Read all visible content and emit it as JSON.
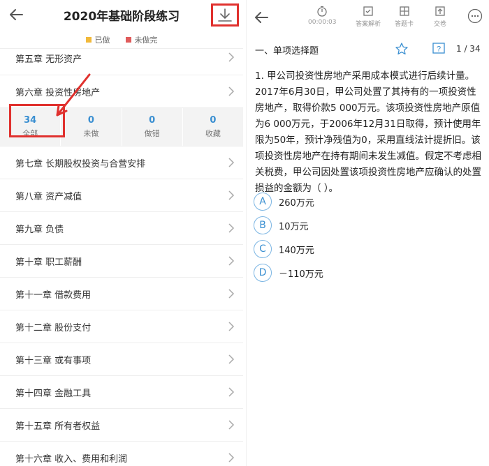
{
  "left": {
    "title": "2020年基础阶段练习",
    "legend": [
      {
        "label": "已做",
        "color": "#f1b93b"
      },
      {
        "label": "未做完",
        "color": "#e05b5b"
      }
    ],
    "chapters_top": [
      {
        "label": "第五章  无形资产"
      },
      {
        "label": "第六章  投资性房地产"
      }
    ],
    "stats": [
      {
        "num": "34",
        "label": "全部"
      },
      {
        "num": "0",
        "label": "未做"
      },
      {
        "num": "0",
        "label": "做错"
      },
      {
        "num": "0",
        "label": "收藏"
      }
    ],
    "chapters_bottom": [
      {
        "label": "第七章  长期股权投资与合营安排"
      },
      {
        "label": "第八章  资产减值"
      },
      {
        "label": "第九章  负债"
      },
      {
        "label": "第十章  职工薪酬"
      },
      {
        "label": "第十一章  借款费用"
      },
      {
        "label": "第十二章  股份支付"
      },
      {
        "label": "第十三章  或有事项"
      },
      {
        "label": "第十四章  金融工具"
      },
      {
        "label": "第十五章  所有者权益"
      },
      {
        "label": "第十六章  收入、费用和利润"
      }
    ]
  },
  "right": {
    "toolbar": {
      "timer": "00:00:03",
      "analysis": "答案解析",
      "answer_card": "答题卡",
      "submit": "交卷"
    },
    "section_title": "一、单项选择题",
    "page_indicator": "1 / 34",
    "question": "1. 甲公司投资性房地产采用成本模式进行后续计量。2017年6月30日，甲公司处置了其持有的一项投资性房地产，取得价款5 000万元。该项投资性房地产原值为6 000万元，于2006年12月31日取得，预计使用年限为50年，预计净残值为0，采用直线法计提折旧。该项投资性房地产在持有期间未发生减值。假定不考虑相关税费，甲公司因处置该项投资性房地产应确认的处置损益的金额为（   ）。",
    "options": [
      {
        "letter": "A",
        "text": "260万元"
      },
      {
        "letter": "B",
        "text": "10万元"
      },
      {
        "letter": "C",
        "text": "140万元"
      },
      {
        "letter": "D",
        "text": "－110万元"
      }
    ]
  },
  "colors": {
    "accent": "#3a8fd1",
    "annotation": "#e0312e"
  }
}
